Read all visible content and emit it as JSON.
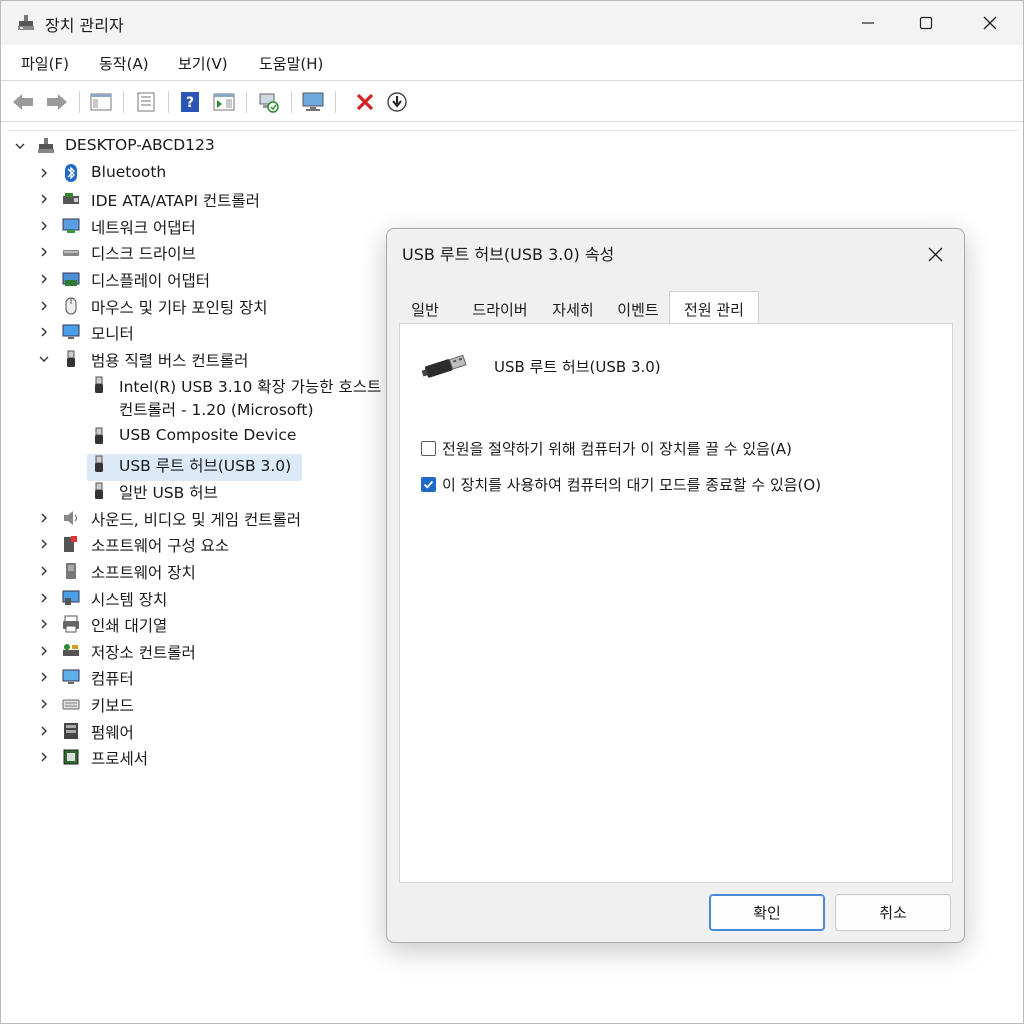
{
  "window": {
    "title": "장치 관리자",
    "icons": {
      "app": "device-manager-icon",
      "minimize": "minimize-icon",
      "maximize": "maximize-icon",
      "close": "close-icon"
    }
  },
  "menu": [
    "파일(F)",
    "동작(A)",
    "보기(V)",
    "도움말(H)"
  ],
  "toolbar": [
    "back-arrow-icon",
    "forward-arrow-icon",
    "show-hide-console-tree-icon",
    "properties-icon",
    "help-icon",
    "action-pane-icon",
    "scan-hardware-icon",
    "display-computer-icon",
    "uninstall-device-icon",
    "update-driver-icon"
  ],
  "tree": {
    "root": "DESKTOP-ABCD123",
    "categories": [
      {
        "label": "Bluetooth",
        "icon": "bluetooth-icon",
        "expanded": false
      },
      {
        "label": "IDE ATA/ATAPI 컨트롤러",
        "icon": "ide-controller-icon",
        "expanded": false
      },
      {
        "label": "네트워크 어댑터",
        "icon": "network-adapter-icon",
        "expanded": false
      },
      {
        "label": "디스크 드라이브",
        "icon": "disk-drive-icon",
        "expanded": false
      },
      {
        "label": "디스플레이 어댑터",
        "icon": "display-adapter-icon",
        "expanded": false
      },
      {
        "label": "마우스 및 기타 포인팅 장치",
        "icon": "mouse-icon",
        "expanded": false
      },
      {
        "label": "모니터",
        "icon": "monitor-icon",
        "expanded": false
      },
      {
        "label": "범용 직렬 버스 컨트롤러",
        "icon": "usb-icon",
        "expanded": true
      },
      {
        "label": "사운드, 비디오 및 게임 컨트롤러",
        "icon": "speaker-icon",
        "expanded": false
      },
      {
        "label": "소프트웨어 구성 요소",
        "icon": "software-component-icon",
        "expanded": false
      },
      {
        "label": "소프트웨어 장치",
        "icon": "software-device-icon",
        "expanded": false
      },
      {
        "label": "시스템 장치",
        "icon": "system-device-icon",
        "expanded": false
      },
      {
        "label": "인쇄 대기열",
        "icon": "printer-icon",
        "expanded": false
      },
      {
        "label": "저장소 컨트롤러",
        "icon": "storage-controller-icon",
        "expanded": false
      },
      {
        "label": "컴퓨터",
        "icon": "computer-icon",
        "expanded": false
      },
      {
        "label": "키보드",
        "icon": "keyboard-icon",
        "expanded": false
      },
      {
        "label": "펌웨어",
        "icon": "firmware-icon",
        "expanded": false
      },
      {
        "label": "프로세서",
        "icon": "processor-icon",
        "expanded": false
      }
    ],
    "usb_children": [
      {
        "line1": "Intel(R) USB 3.10 확장 가능한 호스트",
        "line2": "컨트롤러 - 1.20 (Microsoft)"
      },
      {
        "line1": "USB Composite Device"
      },
      {
        "line1": "USB 루트 허브(USB 3.0)",
        "selected": true
      },
      {
        "line1": "일반 USB 허브"
      }
    ]
  },
  "dialog": {
    "title": "USB 루트 허브(USB 3.0) 속성",
    "tabs": [
      "일반",
      "드라이버",
      "자세히",
      "이벤트",
      "전원 관리"
    ],
    "active_tab": "전원 관리",
    "device_name": "USB 루트 허브(USB 3.0)",
    "options": [
      {
        "label": "전원을 절약하기 위해 컴퓨터가 이 장치를 끌 수 있음(A)",
        "checked": false
      },
      {
        "label": "이 장치를 사용하여 컴퓨터의 대기 모드를 종료할 수 있음(O)",
        "checked": true
      }
    ],
    "ok_label": "확인",
    "cancel_label": "취소"
  }
}
